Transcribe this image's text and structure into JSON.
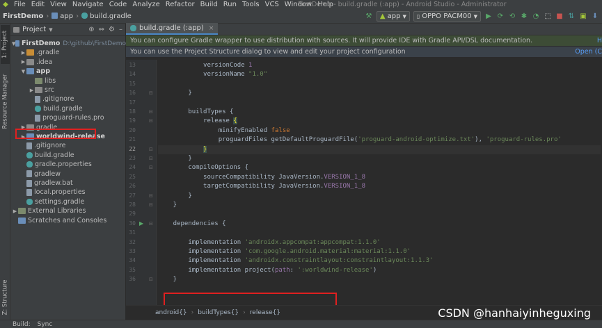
{
  "menu": [
    "File",
    "Edit",
    "View",
    "Navigate",
    "Code",
    "Analyze",
    "Refactor",
    "Build",
    "Run",
    "Tools",
    "VCS",
    "Window",
    "Help"
  ],
  "window_title": "FirstDemo - build.gradle (:app) - Android Studio - Administrator",
  "nav": {
    "project": "FirstDemo",
    "module": "app",
    "file": "build.gradle"
  },
  "toolbar": {
    "config": "app",
    "device": "OPPO PACM00"
  },
  "left_strip": {
    "project_tab": "1: Project",
    "resource_tab": "Resource Manager",
    "structure_tab": "Z: Structure"
  },
  "project_panel": {
    "title": "Project",
    "tree": [
      {
        "label": "FirstDemo",
        "sub": "D:\\github\\FirstDemo",
        "indent": 0,
        "arrow": "▼",
        "icon": "folder-blue",
        "bold": true
      },
      {
        "label": ".gradle",
        "indent": 1,
        "arrow": "▶",
        "icon": "folder-orange"
      },
      {
        "label": ".idea",
        "indent": 1,
        "arrow": "▶",
        "icon": "folder"
      },
      {
        "label": "app",
        "indent": 1,
        "arrow": "▼",
        "icon": "folder-blue",
        "bold": true
      },
      {
        "label": "libs",
        "indent": 2,
        "arrow": "",
        "icon": "libs"
      },
      {
        "label": "src",
        "indent": 2,
        "arrow": "▶",
        "icon": "folder"
      },
      {
        "label": ".gitignore",
        "indent": 2,
        "arrow": "",
        "icon": "file"
      },
      {
        "label": "build.gradle",
        "indent": 2,
        "arrow": "",
        "icon": "gradle"
      },
      {
        "label": "proguard-rules.pro",
        "indent": 2,
        "arrow": "",
        "icon": "file"
      },
      {
        "label": "gradle",
        "indent": 1,
        "arrow": "▶",
        "icon": "folder"
      },
      {
        "label": "worldwind-release",
        "indent": 1,
        "arrow": "▶",
        "icon": "folder-blue",
        "bold": true
      },
      {
        "label": ".gitignore",
        "indent": 1,
        "arrow": "",
        "icon": "file"
      },
      {
        "label": "build.gradle",
        "indent": 1,
        "arrow": "",
        "icon": "gradle"
      },
      {
        "label": "gradle.properties",
        "indent": 1,
        "arrow": "",
        "icon": "gradle"
      },
      {
        "label": "gradlew",
        "indent": 1,
        "arrow": "",
        "icon": "file"
      },
      {
        "label": "gradlew.bat",
        "indent": 1,
        "arrow": "",
        "icon": "file"
      },
      {
        "label": "local.properties",
        "indent": 1,
        "arrow": "",
        "icon": "file"
      },
      {
        "label": "settings.gradle",
        "indent": 1,
        "arrow": "",
        "icon": "gradle"
      },
      {
        "label": "External Libraries",
        "indent": 0,
        "arrow": "▶",
        "icon": "libs"
      },
      {
        "label": "Scratches and Consoles",
        "indent": 0,
        "arrow": "",
        "icon": "folder-blue"
      }
    ]
  },
  "editor": {
    "tab_label": "build.gradle (:app)",
    "banner1": "You can configure Gradle wrapper to use distribution with sources. It will provide IDE with Gradle API/DSL documentation.",
    "banner1_link": "H",
    "banner2": "You can use the Project Structure dialog to view and edit your project configuration",
    "banner2_link": "Open (C",
    "lines": [
      {
        "n": "13",
        "html": "            versionCode <span class=\"param\">1</span>"
      },
      {
        "n": "14",
        "html": "            versionName <span class=\"str\">\"1.0\"</span>"
      },
      {
        "n": "15",
        "html": ""
      },
      {
        "n": "16",
        "html": "        }"
      },
      {
        "n": "17",
        "html": ""
      },
      {
        "n": "18",
        "html": "        buildTypes {"
      },
      {
        "n": "19",
        "html": "            release <span class=\"brace-hl\">{</span>"
      },
      {
        "n": "20",
        "html": "                minifyEnabled <span class=\"kw\">false</span>"
      },
      {
        "n": "21",
        "html": "                proguardFiles getDefaultProguardFile(<span class=\"str\">'proguard-android-optimize.txt'</span>), <span class=\"str\">'proguard-rules.pro'</span>"
      },
      {
        "n": "22",
        "html": "            <span class=\"brace-hl\">}</span>",
        "current": true
      },
      {
        "n": "23",
        "html": "        }"
      },
      {
        "n": "24",
        "html": "        compileOptions {"
      },
      {
        "n": "25",
        "html": "            sourceCompatibility JavaVersion.<span class=\"param\">VERSION_1_8</span>"
      },
      {
        "n": "26",
        "html": "            targetCompatibility JavaVersion.<span class=\"param\">VERSION_1_8</span>"
      },
      {
        "n": "27",
        "html": "        }"
      },
      {
        "n": "28",
        "html": "    }"
      },
      {
        "n": "29",
        "html": ""
      },
      {
        "n": "30",
        "html": "    dependencies {",
        "run": true
      },
      {
        "n": "31",
        "html": ""
      },
      {
        "n": "32",
        "html": "        implementation <span class=\"str\">'androidx.appcompat:appcompat:1.1.0'</span>"
      },
      {
        "n": "33",
        "html": "        implementation <span class=\"str\">'com.google.android.material:material:1.1.0'</span>"
      },
      {
        "n": "34",
        "html": "        implementation <span class=\"str\">'androidx.constraintlayout:constraintlayout:1.1.3'</span>"
      },
      {
        "n": "35",
        "html": "        implementation project(<span class=\"param\">path</span>: <span class=\"str\">':worldwind-release'</span>)"
      },
      {
        "n": "36",
        "html": "    }"
      }
    ],
    "breadcrumbs": [
      "android{}",
      "buildTypes{}",
      "release{}"
    ]
  },
  "watermark": "CSDN @hanhaiyinheguxing",
  "status": {
    "build": "Build:",
    "sync": "Sync"
  },
  "colors": {
    "highlight_box": "#e02020",
    "accent": "#4a88c7"
  }
}
